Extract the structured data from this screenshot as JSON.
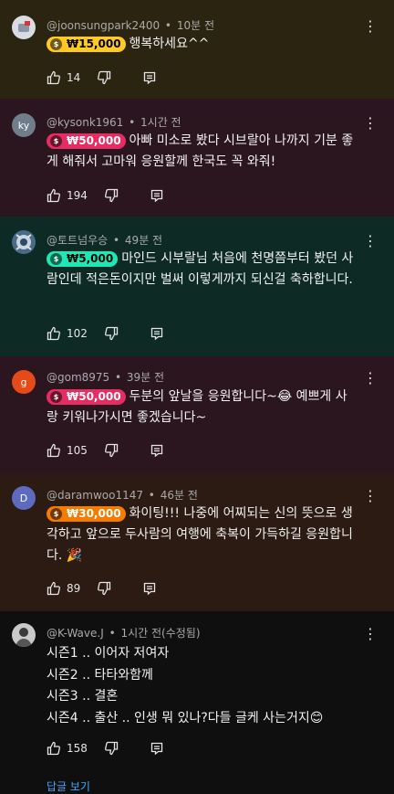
{
  "comments": [
    {
      "author": "@joonsungpark2400",
      "time": "10분 전",
      "amount": "₩15,000",
      "chip_color": "#ffca28",
      "text": "행복하세요^^",
      "likes": "14",
      "bg": "#2a2411",
      "avatar_letter": "",
      "avatar_color": "#d8dce3"
    },
    {
      "author": "@kysonk1961",
      "time": "1시간 전",
      "amount": "₩50,000",
      "chip_color": "#e62d63",
      "text": "아빠 미소로 봤다 시브랄아 나까지 기분 좋게 해줘서 고마워 응원할께 한국도 꼭 와줘!",
      "likes": "194",
      "bg": "#2b1620",
      "avatar_letter": "ky",
      "avatar_color": "#6f7e8a"
    },
    {
      "author": "@토트넘우승",
      "time": "49분 전",
      "amount": "₩5,000",
      "chip_color": "#1de9b6",
      "text": "마인드 시부랄님 처음에 천명쯤부터 봤던 사람인데 적은돈이지만 벌써 이렇게까지 되신걸 축하합니다.",
      "likes": "102",
      "bg": "#0d2b24",
      "avatar_letter": "",
      "avatar_color": "#4b6a86"
    },
    {
      "author": "@gom8975",
      "time": "39분 전",
      "amount": "₩50,000",
      "chip_color": "#e62d63",
      "text": "두분의 앞날을 응원합니다~😂 예쁘게 사랑 키워나가시면 좋겠습니다~",
      "likes": "105",
      "bg": "#2b1620",
      "avatar_letter": "g",
      "avatar_color": "#e64a19"
    },
    {
      "author": "@daramwoo1147",
      "time": "46분 전",
      "amount": "₩30,000",
      "chip_color": "#f57c00",
      "text": "화이팅!!! 나중에 어찌되는 신의 뜻으로 생각하고 앞으로 두사람의 여행에 축복이 가득하길 응원합니다. 🎉",
      "likes": "89",
      "bg": "#2b1b12",
      "avatar_letter": "D",
      "avatar_color": "#5c6bc0"
    },
    {
      "author": "@K-Wave.J",
      "time": "1시간 전(수정됨)",
      "amount": "",
      "chip_color": "",
      "lines": [
        "시즌1 .. 이어자 저여자",
        "시즌2 .. 타타와함께",
        "시즌3 .. 결혼",
        "시즌4 .. 출산 .. 인생 뭐 있나?다들 글케 사는거지😊"
      ],
      "likes": "158",
      "bg": "#0f0f0f",
      "avatar_letter": "",
      "avatar_color": "#c9c9c9"
    }
  ],
  "bottom_link": "답글 보기"
}
